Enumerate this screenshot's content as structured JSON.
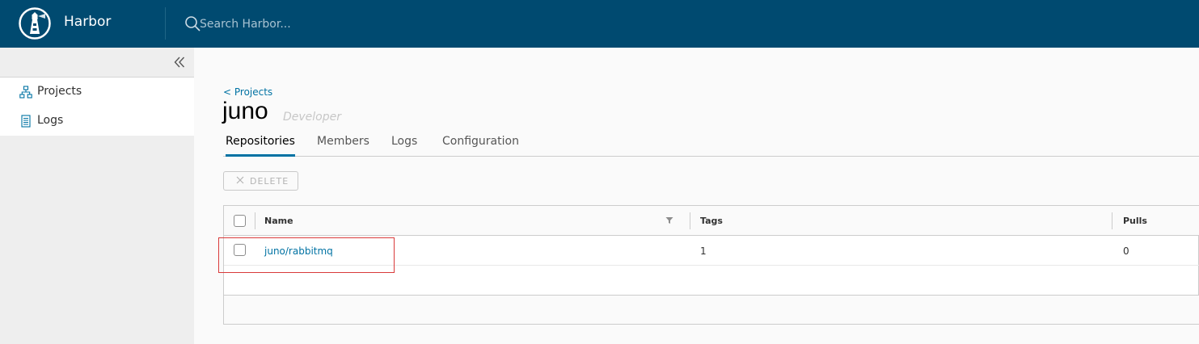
{
  "header": {
    "brand": "Harbor",
    "search_placeholder": "Search Harbor...",
    "logo_icon": "lighthouse-icon",
    "search_icon": "search-icon"
  },
  "sidebar": {
    "collapse_icon": "double-chevron-left-icon",
    "items": [
      {
        "label": "Projects",
        "icon": "projects-icon"
      },
      {
        "label": "Logs",
        "icon": "logs-icon"
      }
    ]
  },
  "main": {
    "breadcrumb": "< Projects",
    "title": "juno",
    "role": "Developer",
    "tabs": [
      {
        "label": "Repositories",
        "active": true
      },
      {
        "label": "Members",
        "active": false
      },
      {
        "label": "Logs",
        "active": false
      },
      {
        "label": "Configuration",
        "active": false
      }
    ],
    "delete_label": "DELETE",
    "table": {
      "columns": [
        "Name",
        "Tags",
        "Pulls"
      ],
      "rows": [
        {
          "name": "juno/rabbitmq",
          "tags": "1",
          "pulls": "0"
        }
      ]
    }
  },
  "colors": {
    "header_bg": "#004a70",
    "accent": "#0072a3",
    "highlight": "#d93a3a"
  }
}
